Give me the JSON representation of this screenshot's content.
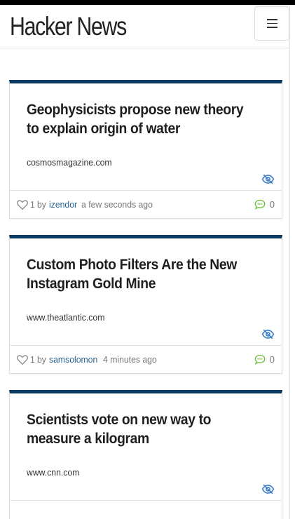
{
  "app": {
    "title": "Hacker News"
  },
  "header": {
    "menu_icon": "hamburger-menu-icon"
  },
  "colors": {
    "card_accent": "#0b3a63",
    "author_link": "#2a6496",
    "eye_icon": "#3a7dc9",
    "comment_icon": "#6cbf3b"
  },
  "stories": [
    {
      "title": "Geophysicists propose new theory to explain origin of water",
      "domain": "cosmosmagazine.com",
      "points": "1",
      "by": "by",
      "author": "izendor",
      "time": "a few seconds ago",
      "comments": "0"
    },
    {
      "title": "Custom Photo Filters Are the New Instagram Gold Mine",
      "domain": "www.theatlantic.com",
      "points": "1",
      "by": "by",
      "author": "samsolomon",
      "time": "4 minutes ago",
      "comments": "0"
    },
    {
      "title": "Scientists vote on new way to measure a kilogram",
      "domain": "www.cnn.com",
      "points": "",
      "by": "",
      "author": "",
      "time": "",
      "comments": ""
    }
  ]
}
